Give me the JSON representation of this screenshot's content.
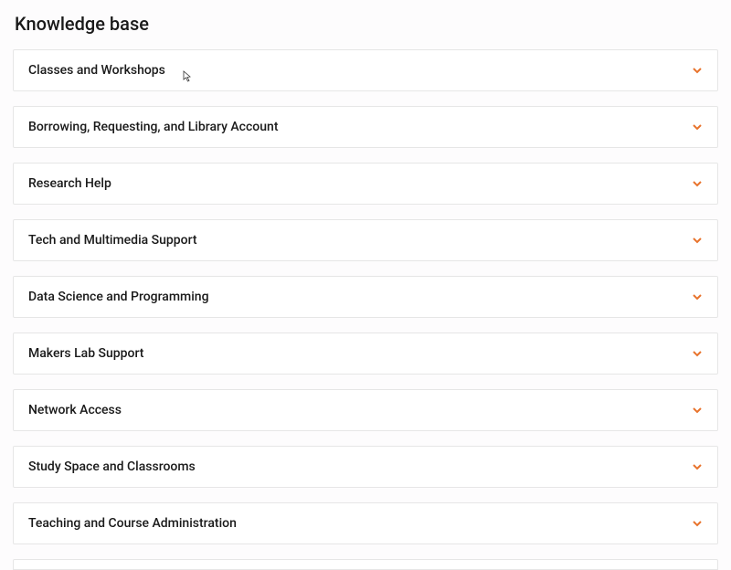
{
  "header": {
    "title": "Knowledge base"
  },
  "accordion": {
    "items": [
      {
        "label": "Classes and Workshops"
      },
      {
        "label": "Borrowing, Requesting, and Library Account"
      },
      {
        "label": "Research Help"
      },
      {
        "label": "Tech and Multimedia Support"
      },
      {
        "label": "Data Science and Programming"
      },
      {
        "label": "Makers Lab Support"
      },
      {
        "label": "Network Access"
      },
      {
        "label": "Study Space and Classrooms"
      },
      {
        "label": "Teaching and Course Administration"
      }
    ]
  },
  "colors": {
    "accent": "#e8732c",
    "border": "#e6e6e6",
    "text": "#1a1a1a",
    "background": "#fdfcfd"
  }
}
